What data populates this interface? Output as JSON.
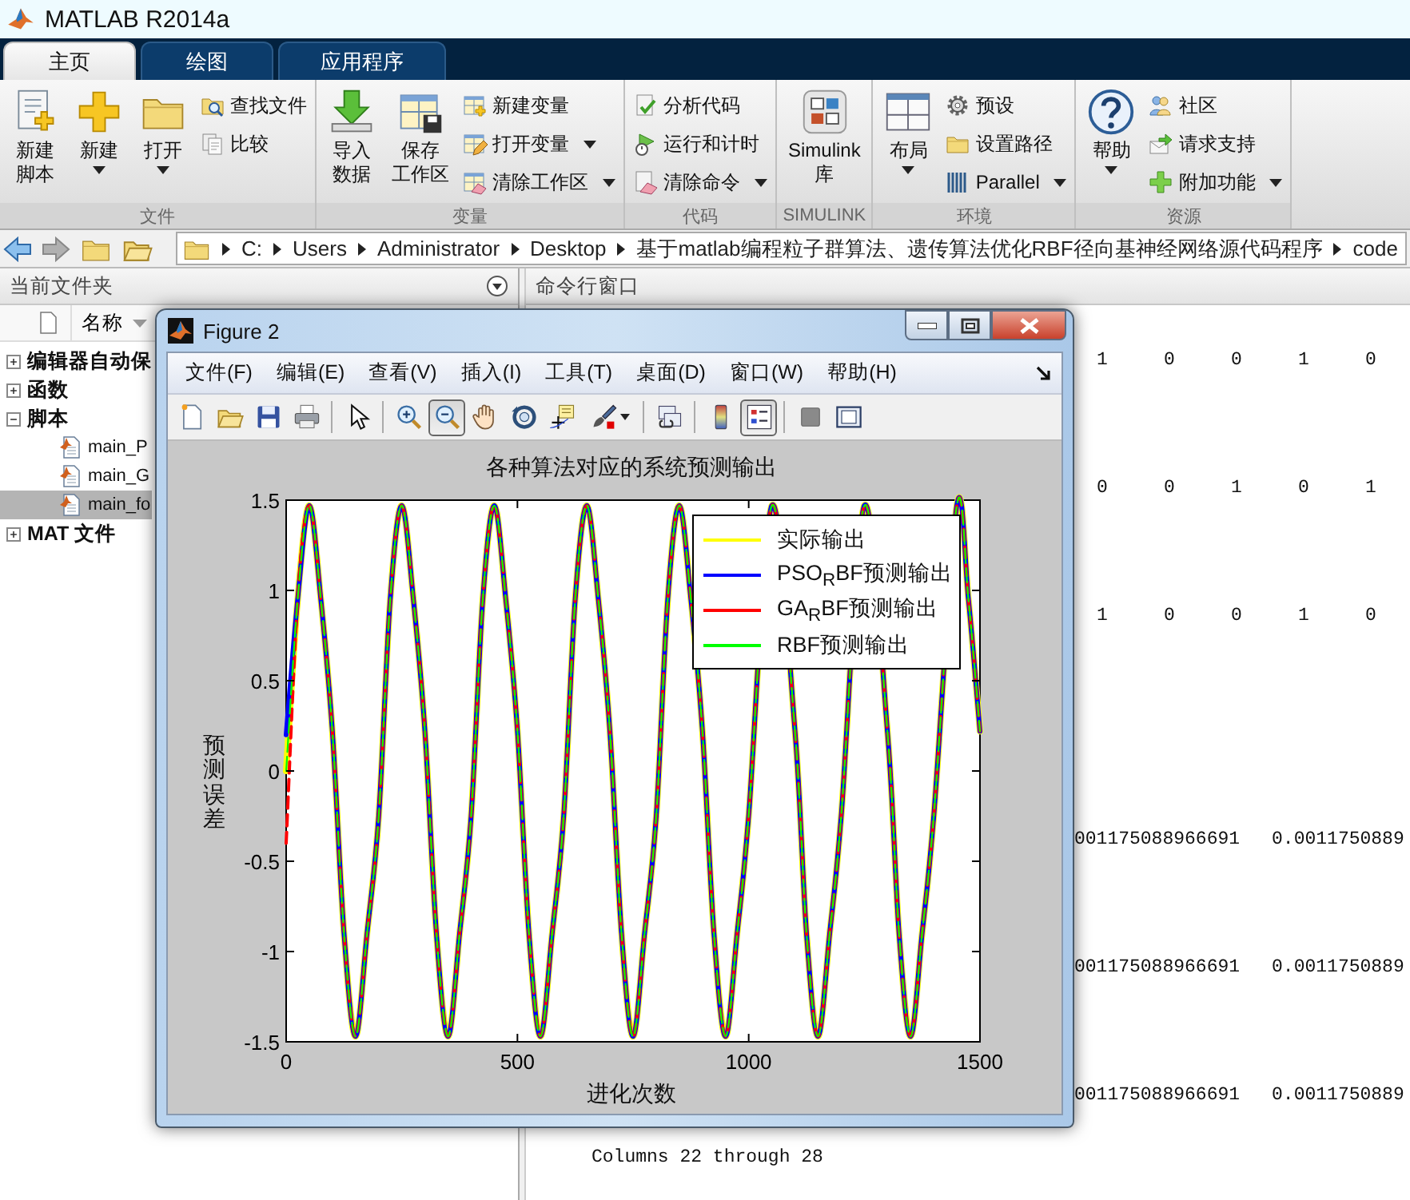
{
  "window": {
    "title": "MATLAB R2014a"
  },
  "tabs": [
    {
      "label": "主页",
      "selected": true
    },
    {
      "label": "绘图",
      "selected": false
    },
    {
      "label": "应用程序",
      "selected": false
    }
  ],
  "ribbon": {
    "groups": [
      {
        "label": "文件",
        "items": [
          {
            "kind": "large",
            "lines": [
              "新建",
              "脚本"
            ],
            "dropdown": false
          },
          {
            "kind": "large",
            "lines": [
              "新建"
            ],
            "dropdown": true
          },
          {
            "kind": "large",
            "lines": [
              "打开"
            ],
            "dropdown": true
          },
          {
            "kind": "small",
            "label": "查找文件",
            "dropdown": false
          },
          {
            "kind": "small",
            "label": "比较",
            "dropdown": false
          }
        ]
      },
      {
        "label": "变量",
        "items": [
          {
            "kind": "large",
            "lines": [
              "导入",
              "数据"
            ],
            "dropdown": false
          },
          {
            "kind": "large",
            "lines": [
              "保存",
              "工作区"
            ],
            "dropdown": false
          },
          {
            "kind": "small",
            "label": "新建变量",
            "dropdown": false
          },
          {
            "kind": "small",
            "label": "打开变量",
            "dropdown": true
          },
          {
            "kind": "small",
            "label": "清除工作区",
            "dropdown": true
          }
        ]
      },
      {
        "label": "代码",
        "items": [
          {
            "kind": "small",
            "label": "分析代码",
            "dropdown": false
          },
          {
            "kind": "small",
            "label": "运行和计时",
            "dropdown": false
          },
          {
            "kind": "small",
            "label": "清除命令",
            "dropdown": true
          }
        ]
      },
      {
        "label": "SIMULINK",
        "items": [
          {
            "kind": "large",
            "lines": [
              "Simulink",
              "库"
            ],
            "dropdown": false
          }
        ]
      },
      {
        "label": "环境",
        "items": [
          {
            "kind": "large",
            "lines": [
              "布局"
            ],
            "dropdown": true
          },
          {
            "kind": "small",
            "label": "预设",
            "dropdown": false
          },
          {
            "kind": "small",
            "label": "设置路径",
            "dropdown": false
          },
          {
            "kind": "small",
            "label": "Parallel",
            "dropdown": true
          }
        ]
      },
      {
        "label": "资源",
        "items": [
          {
            "kind": "large",
            "lines": [
              "帮助"
            ],
            "dropdown": true
          },
          {
            "kind": "small",
            "label": "社区",
            "dropdown": false
          },
          {
            "kind": "small",
            "label": "请求支持",
            "dropdown": false
          },
          {
            "kind": "small",
            "label": "附加功能",
            "dropdown": true
          }
        ]
      }
    ]
  },
  "address_bar": {
    "crumbs": [
      "C:",
      "Users",
      "Administrator",
      "Desktop",
      "基于matlab编程粒子群算法、遗传算法优化RBF径向基神经网络源代码程序",
      "code"
    ]
  },
  "current_folder": {
    "title": "当前文件夹",
    "column": "名称",
    "tree": [
      {
        "kind": "group",
        "label": "编辑器自动保",
        "expanded": false
      },
      {
        "kind": "group",
        "label": "函数",
        "expanded": false
      },
      {
        "kind": "group",
        "label": "脚本",
        "expanded": true,
        "children": [
          {
            "kind": "file",
            "label": "main_P",
            "selected": false
          },
          {
            "kind": "file",
            "label": "main_G",
            "selected": false
          },
          {
            "kind": "file",
            "label": "main_fo",
            "selected": true
          }
        ]
      },
      {
        "kind": "group",
        "label": "MAT 文件",
        "expanded": false
      }
    ]
  },
  "command_window": {
    "title": "命令行窗口",
    "blocks": [
      {
        "kind": "integers",
        "rows": [
          [
            "1",
            "0",
            "0",
            "1",
            "0"
          ],
          [
            "0",
            "0",
            "1",
            "0",
            "1"
          ],
          [
            "1",
            "0",
            "0",
            "1",
            "0"
          ]
        ]
      },
      {
        "kind": "decimals",
        "rows": [
          [
            "001175088966691",
            "0.0011750889"
          ],
          [
            "001175088966691",
            "0.0011750889"
          ],
          [
            "001175088966691",
            "0.0011750889"
          ]
        ]
      },
      {
        "kind": "text",
        "text": "Columns 22 through 28"
      }
    ]
  },
  "figure": {
    "title": "Figure 2",
    "menu": [
      "文件(F)",
      "编辑(E)",
      "查看(V)",
      "插入(I)",
      "工具(T)",
      "桌面(D)",
      "窗口(W)",
      "帮助(H)"
    ],
    "toolbar": [
      [
        {
          "pressed": false
        },
        {
          "pressed": false
        },
        {
          "pressed": false
        },
        {
          "pressed": false
        }
      ],
      [
        {
          "pressed": false
        }
      ],
      [
        {
          "pressed": false
        },
        {
          "pressed": true
        },
        {
          "pressed": false
        },
        {
          "pressed": false
        },
        {
          "pressed": false
        },
        {
          "pressed": false
        }
      ],
      [
        {
          "pressed": false
        }
      ],
      [
        {
          "pressed": false
        },
        {
          "pressed": true
        }
      ],
      [
        {
          "pressed": false
        },
        {
          "pressed": false
        }
      ]
    ],
    "chart_data": {
      "type": "line",
      "title": "各种算法对应的系统预测输出",
      "xlabel": "进化次数",
      "ylabel": "预测误差",
      "x": [
        0,
        25,
        50,
        75,
        100,
        125,
        150,
        175,
        200,
        225,
        250,
        275,
        300,
        325,
        350,
        375,
        400,
        425,
        450,
        475,
        500,
        525,
        550,
        575,
        600,
        625,
        650,
        675,
        700,
        725,
        750,
        775,
        800,
        825,
        850,
        875,
        900,
        925,
        950,
        975,
        1000,
        1050,
        1100,
        1125,
        1150,
        1175,
        1200,
        1250,
        1300,
        1325,
        1350,
        1375,
        1400,
        1450,
        1475,
        1500
      ],
      "series": [
        {
          "name": "实际输出",
          "color": "#ffff00",
          "line_style": "solid",
          "values": [
            0,
            0.95,
            1.47,
            0.95,
            0.22,
            -0.9,
            -1.47,
            -0.9,
            -0.25,
            0.95,
            1.47,
            0.95,
            0.22,
            -0.9,
            -1.47,
            -0.9,
            -0.25,
            0.95,
            1.47,
            0.95,
            0.22,
            -0.9,
            -1.47,
            -0.9,
            -0.25,
            0.95,
            1.47,
            0.95,
            0.22,
            -0.9,
            -1.47,
            -0.9,
            -0.25,
            0.95,
            1.47,
            0.95,
            0.22,
            -0.9,
            -1.47,
            -0.9,
            -0.25,
            1.47,
            0.22,
            -0.9,
            -1.47,
            -0.9,
            -0.25,
            1.47,
            0.22,
            -0.9,
            -1.47,
            -0.9,
            -0.25,
            1.47,
            0.95,
            0.22
          ]
        },
        {
          "name": "PSO$_{R}$BF预测输出",
          "color": "#0000ff",
          "line_style": "solid",
          "values": [
            0.2,
            0.95,
            1.47,
            0.95,
            0.22,
            -0.9,
            -1.47,
            -0.9,
            -0.25,
            0.95,
            1.47,
            0.95,
            0.22,
            -0.9,
            -1.47,
            -0.9,
            -0.25,
            0.95,
            1.47,
            0.95,
            0.22,
            -0.9,
            -1.47,
            -0.9,
            -0.25,
            0.95,
            1.47,
            0.95,
            0.22,
            -0.9,
            -1.47,
            -0.9,
            -0.25,
            0.95,
            1.47,
            0.95,
            0.22,
            -0.9,
            -1.47,
            -0.9,
            -0.25,
            1.47,
            0.22,
            -0.9,
            -1.47,
            -0.9,
            -0.25,
            1.47,
            0.22,
            -0.9,
            -1.47,
            -0.9,
            -0.25,
            1.47,
            0.95,
            0.22
          ]
        },
        {
          "name": "GA$_{R}$BF预测输出",
          "color": "#ff0000",
          "line_style": "dashed",
          "values": [
            -0.4,
            0.95,
            1.47,
            0.95,
            0.22,
            -0.9,
            -1.47,
            -0.9,
            -0.25,
            0.95,
            1.47,
            0.95,
            0.22,
            -0.9,
            -1.47,
            -0.9,
            -0.25,
            0.95,
            1.47,
            0.95,
            0.22,
            -0.9,
            -1.47,
            -0.9,
            -0.25,
            0.95,
            1.47,
            0.95,
            0.22,
            -0.9,
            -1.47,
            -0.9,
            -0.25,
            0.95,
            1.47,
            0.95,
            0.22,
            -0.9,
            -1.47,
            -0.9,
            -0.25,
            1.47,
            0.22,
            -0.9,
            -1.47,
            -0.9,
            -0.25,
            1.47,
            0.22,
            -0.9,
            -1.47,
            -0.9,
            -0.25,
            1.47,
            0.95,
            0.22
          ]
        },
        {
          "name": "RBF预测输出",
          "color": "#00ff00",
          "line_style": "dashed",
          "values": [
            0,
            0.95,
            1.47,
            0.95,
            0.22,
            -0.9,
            -1.47,
            -0.9,
            -0.25,
            0.95,
            1.47,
            0.95,
            0.22,
            -0.9,
            -1.47,
            -0.9,
            -0.25,
            0.95,
            1.47,
            0.95,
            0.22,
            -0.9,
            -1.47,
            -0.9,
            -0.25,
            0.95,
            1.47,
            0.95,
            0.22,
            -0.9,
            -1.47,
            -0.9,
            -0.25,
            0.95,
            1.47,
            0.95,
            0.22,
            -0.9,
            -1.47,
            -0.9,
            -0.25,
            1.47,
            0.22,
            -0.9,
            -1.47,
            -0.9,
            -0.25,
            1.47,
            0.22,
            -0.9,
            -1.47,
            -0.9,
            -0.25,
            1.47,
            0.95,
            0.22
          ]
        }
      ],
      "legend": true,
      "xlim": [
        0,
        1500
      ],
      "ylim": [
        -1.5,
        1.5
      ],
      "xticks": [
        0,
        500,
        1000,
        1500
      ],
      "yticks": [
        -1.5,
        -1,
        -0.5,
        0,
        0.5,
        1,
        1.5
      ]
    }
  }
}
